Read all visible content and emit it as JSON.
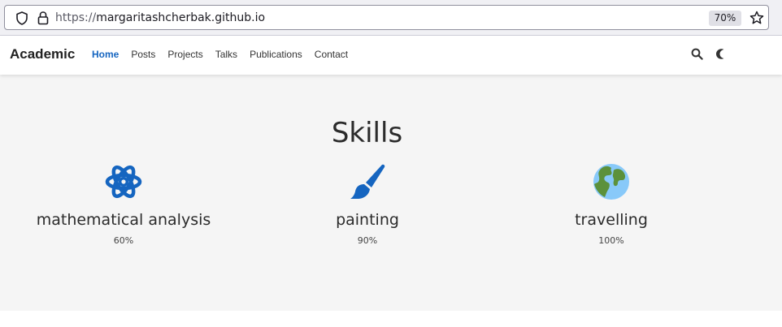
{
  "browser": {
    "url_protocol": "https://",
    "url_host": "margaritashcherbak.github.io",
    "zoom": "70%",
    "icons": [
      "shield-icon",
      "lock-icon",
      "bookmark-star-icon"
    ]
  },
  "navbar": {
    "brand": "Academic",
    "links": [
      {
        "label": "Home",
        "active": true
      },
      {
        "label": "Posts",
        "active": false
      },
      {
        "label": "Projects",
        "active": false
      },
      {
        "label": "Talks",
        "active": false
      },
      {
        "label": "Publications",
        "active": false
      },
      {
        "label": "Contact",
        "active": false
      }
    ],
    "icons": [
      "search-icon",
      "dark-mode-moon-icon"
    ],
    "active_color": "#1565c0"
  },
  "skills": {
    "title": "Skills",
    "icon_color": "#1565c0",
    "items": [
      {
        "name": "mathematical analysis",
        "percent": "60%",
        "icon": "atom-icon"
      },
      {
        "name": "painting",
        "percent": "90%",
        "icon": "paint-brush-icon"
      },
      {
        "name": "travelling",
        "percent": "100%",
        "icon": "globe-icon"
      }
    ]
  }
}
